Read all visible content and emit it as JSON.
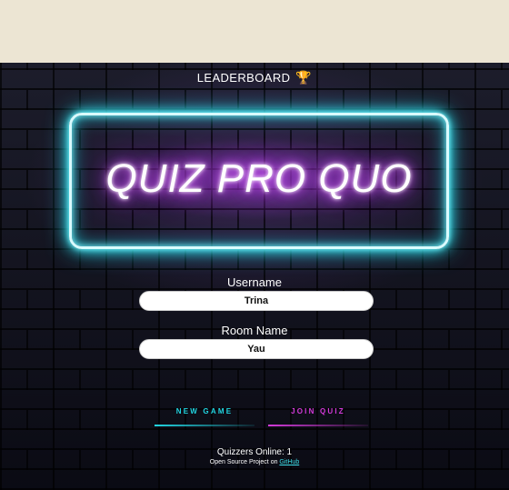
{
  "header": {
    "leaderboard_label": "LEADERBOARD",
    "trophy_icon": "trophy-icon",
    "trophy_color": "#3ee0ea"
  },
  "hero": {
    "title": "QUIZ PRO QUO",
    "neon_frame_color": "#38e6f2",
    "neon_text_glow": "#c23fff"
  },
  "form": {
    "username_label": "Username",
    "username_value": "Trina",
    "room_label": "Room Name",
    "room_value": "Yau"
  },
  "actions": {
    "new_game_label": "NEW GAME",
    "new_game_color": "#21d6e2",
    "join_quiz_label": "JOIN QUIZ",
    "join_quiz_color": "#d43ad9"
  },
  "footer": {
    "online_text": "Quizzers Online: 1",
    "oss_prefix": "Open Source Project on ",
    "github_link": "GitHub"
  }
}
